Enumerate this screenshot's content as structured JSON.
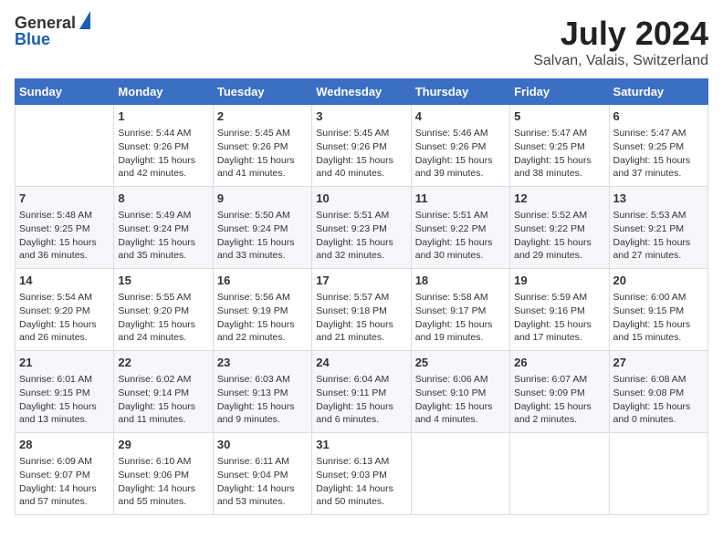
{
  "header": {
    "logo_general": "General",
    "logo_blue": "Blue",
    "title": "July 2024",
    "location": "Salvan, Valais, Switzerland"
  },
  "days_of_week": [
    "Sunday",
    "Monday",
    "Tuesday",
    "Wednesday",
    "Thursday",
    "Friday",
    "Saturday"
  ],
  "weeks": [
    [
      {
        "day": "",
        "sunrise": "",
        "sunset": "",
        "daylight": ""
      },
      {
        "day": "1",
        "sunrise": "Sunrise: 5:44 AM",
        "sunset": "Sunset: 9:26 PM",
        "daylight": "Daylight: 15 hours and 42 minutes."
      },
      {
        "day": "2",
        "sunrise": "Sunrise: 5:45 AM",
        "sunset": "Sunset: 9:26 PM",
        "daylight": "Daylight: 15 hours and 41 minutes."
      },
      {
        "day": "3",
        "sunrise": "Sunrise: 5:45 AM",
        "sunset": "Sunset: 9:26 PM",
        "daylight": "Daylight: 15 hours and 40 minutes."
      },
      {
        "day": "4",
        "sunrise": "Sunrise: 5:46 AM",
        "sunset": "Sunset: 9:26 PM",
        "daylight": "Daylight: 15 hours and 39 minutes."
      },
      {
        "day": "5",
        "sunrise": "Sunrise: 5:47 AM",
        "sunset": "Sunset: 9:25 PM",
        "daylight": "Daylight: 15 hours and 38 minutes."
      },
      {
        "day": "6",
        "sunrise": "Sunrise: 5:47 AM",
        "sunset": "Sunset: 9:25 PM",
        "daylight": "Daylight: 15 hours and 37 minutes."
      }
    ],
    [
      {
        "day": "7",
        "sunrise": "Sunrise: 5:48 AM",
        "sunset": "Sunset: 9:25 PM",
        "daylight": "Daylight: 15 hours and 36 minutes."
      },
      {
        "day": "8",
        "sunrise": "Sunrise: 5:49 AM",
        "sunset": "Sunset: 9:24 PM",
        "daylight": "Daylight: 15 hours and 35 minutes."
      },
      {
        "day": "9",
        "sunrise": "Sunrise: 5:50 AM",
        "sunset": "Sunset: 9:24 PM",
        "daylight": "Daylight: 15 hours and 33 minutes."
      },
      {
        "day": "10",
        "sunrise": "Sunrise: 5:51 AM",
        "sunset": "Sunset: 9:23 PM",
        "daylight": "Daylight: 15 hours and 32 minutes."
      },
      {
        "day": "11",
        "sunrise": "Sunrise: 5:51 AM",
        "sunset": "Sunset: 9:22 PM",
        "daylight": "Daylight: 15 hours and 30 minutes."
      },
      {
        "day": "12",
        "sunrise": "Sunrise: 5:52 AM",
        "sunset": "Sunset: 9:22 PM",
        "daylight": "Daylight: 15 hours and 29 minutes."
      },
      {
        "day": "13",
        "sunrise": "Sunrise: 5:53 AM",
        "sunset": "Sunset: 9:21 PM",
        "daylight": "Daylight: 15 hours and 27 minutes."
      }
    ],
    [
      {
        "day": "14",
        "sunrise": "Sunrise: 5:54 AM",
        "sunset": "Sunset: 9:20 PM",
        "daylight": "Daylight: 15 hours and 26 minutes."
      },
      {
        "day": "15",
        "sunrise": "Sunrise: 5:55 AM",
        "sunset": "Sunset: 9:20 PM",
        "daylight": "Daylight: 15 hours and 24 minutes."
      },
      {
        "day": "16",
        "sunrise": "Sunrise: 5:56 AM",
        "sunset": "Sunset: 9:19 PM",
        "daylight": "Daylight: 15 hours and 22 minutes."
      },
      {
        "day": "17",
        "sunrise": "Sunrise: 5:57 AM",
        "sunset": "Sunset: 9:18 PM",
        "daylight": "Daylight: 15 hours and 21 minutes."
      },
      {
        "day": "18",
        "sunrise": "Sunrise: 5:58 AM",
        "sunset": "Sunset: 9:17 PM",
        "daylight": "Daylight: 15 hours and 19 minutes."
      },
      {
        "day": "19",
        "sunrise": "Sunrise: 5:59 AM",
        "sunset": "Sunset: 9:16 PM",
        "daylight": "Daylight: 15 hours and 17 minutes."
      },
      {
        "day": "20",
        "sunrise": "Sunrise: 6:00 AM",
        "sunset": "Sunset: 9:15 PM",
        "daylight": "Daylight: 15 hours and 15 minutes."
      }
    ],
    [
      {
        "day": "21",
        "sunrise": "Sunrise: 6:01 AM",
        "sunset": "Sunset: 9:15 PM",
        "daylight": "Daylight: 15 hours and 13 minutes."
      },
      {
        "day": "22",
        "sunrise": "Sunrise: 6:02 AM",
        "sunset": "Sunset: 9:14 PM",
        "daylight": "Daylight: 15 hours and 11 minutes."
      },
      {
        "day": "23",
        "sunrise": "Sunrise: 6:03 AM",
        "sunset": "Sunset: 9:13 PM",
        "daylight": "Daylight: 15 hours and 9 minutes."
      },
      {
        "day": "24",
        "sunrise": "Sunrise: 6:04 AM",
        "sunset": "Sunset: 9:11 PM",
        "daylight": "Daylight: 15 hours and 6 minutes."
      },
      {
        "day": "25",
        "sunrise": "Sunrise: 6:06 AM",
        "sunset": "Sunset: 9:10 PM",
        "daylight": "Daylight: 15 hours and 4 minutes."
      },
      {
        "day": "26",
        "sunrise": "Sunrise: 6:07 AM",
        "sunset": "Sunset: 9:09 PM",
        "daylight": "Daylight: 15 hours and 2 minutes."
      },
      {
        "day": "27",
        "sunrise": "Sunrise: 6:08 AM",
        "sunset": "Sunset: 9:08 PM",
        "daylight": "Daylight: 15 hours and 0 minutes."
      }
    ],
    [
      {
        "day": "28",
        "sunrise": "Sunrise: 6:09 AM",
        "sunset": "Sunset: 9:07 PM",
        "daylight": "Daylight: 14 hours and 57 minutes."
      },
      {
        "day": "29",
        "sunrise": "Sunrise: 6:10 AM",
        "sunset": "Sunset: 9:06 PM",
        "daylight": "Daylight: 14 hours and 55 minutes."
      },
      {
        "day": "30",
        "sunrise": "Sunrise: 6:11 AM",
        "sunset": "Sunset: 9:04 PM",
        "daylight": "Daylight: 14 hours and 53 minutes."
      },
      {
        "day": "31",
        "sunrise": "Sunrise: 6:13 AM",
        "sunset": "Sunset: 9:03 PM",
        "daylight": "Daylight: 14 hours and 50 minutes."
      },
      {
        "day": "",
        "sunrise": "",
        "sunset": "",
        "daylight": ""
      },
      {
        "day": "",
        "sunrise": "",
        "sunset": "",
        "daylight": ""
      },
      {
        "day": "",
        "sunrise": "",
        "sunset": "",
        "daylight": ""
      }
    ]
  ]
}
